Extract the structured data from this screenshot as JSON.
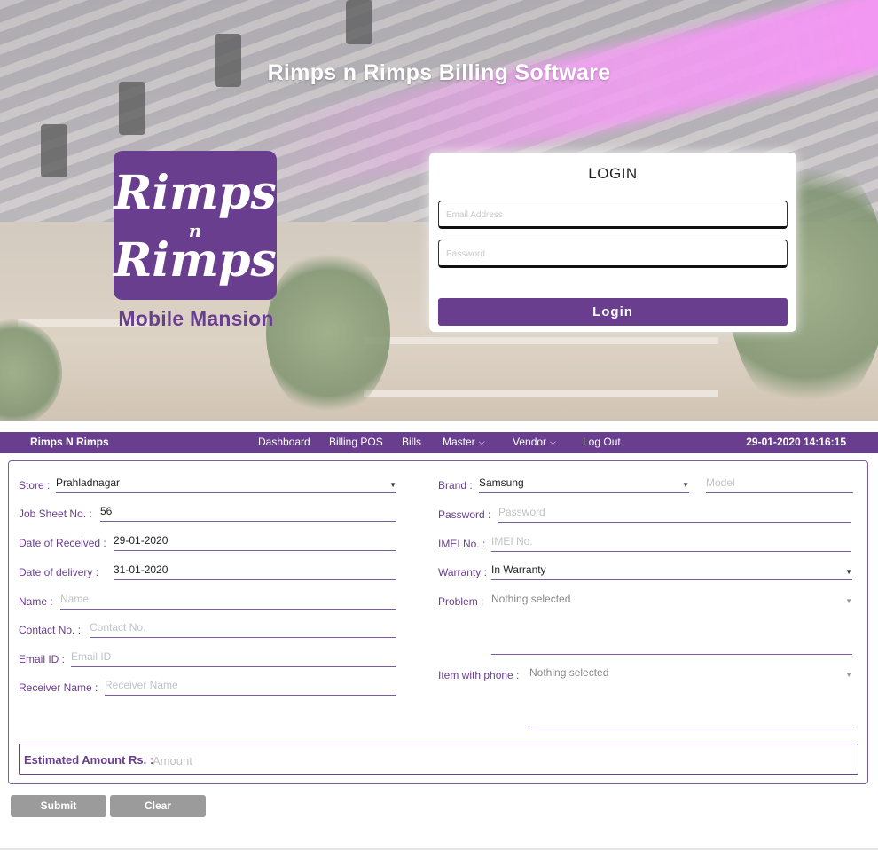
{
  "hero": {
    "title": "Rimps n Rimps  Billing Software",
    "logo": {
      "line1": "Rimps",
      "line2": "n",
      "line3": "Rimps",
      "subtitle": "Mobile Mansion"
    }
  },
  "login": {
    "title": "LOGIN",
    "email_placeholder": "Email Address",
    "password_placeholder": "Password",
    "button_label": "Login"
  },
  "nav": {
    "brand": "Rimps N Rimps",
    "items": [
      {
        "label": "Dashboard"
      },
      {
        "label": "Billing POS"
      },
      {
        "label": "Bills"
      },
      {
        "label": "Master",
        "dropdown": true
      },
      {
        "label": "Vendor",
        "dropdown": true
      },
      {
        "label": "Log Out"
      }
    ],
    "datetime": "29-01-2020 14:16:15"
  },
  "form": {
    "store": {
      "label": "Store :",
      "value": "Prahladnagar"
    },
    "job_sheet": {
      "label": "Job Sheet No. :",
      "value": "56"
    },
    "date_received": {
      "label": "Date of Received :",
      "value": "29-01-2020"
    },
    "date_delivery": {
      "label": "Date of delivery :",
      "value": "31-01-2020"
    },
    "name": {
      "label": "Name :",
      "placeholder": "Name"
    },
    "contact": {
      "label": "Contact No. :",
      "placeholder": "Contact No."
    },
    "email": {
      "label": "Email ID :",
      "placeholder": "Email ID"
    },
    "receiver": {
      "label": "Receiver Name :",
      "placeholder": "Receiver Name"
    },
    "brand": {
      "label": "Brand :",
      "value": "Samsung"
    },
    "model": {
      "placeholder": "Model"
    },
    "password": {
      "label": "Password :",
      "placeholder": "Password"
    },
    "imei": {
      "label": "IMEI No. :",
      "placeholder": "IMEI No."
    },
    "warranty": {
      "label": "Warranty :",
      "value": "In Warranty"
    },
    "problem": {
      "label": "Problem :",
      "value": "Nothing selected"
    },
    "item_with_phone": {
      "label": "Item with phone :",
      "value": "Nothing selected"
    },
    "amount": {
      "label": "Estimated Amount Rs. :",
      "placeholder": "Amount"
    }
  },
  "actions": {
    "submit_label": "Submit",
    "clear_label": "Clear"
  },
  "colors": {
    "brand": "#693e8e",
    "button_grey": "#9b9b9b"
  }
}
